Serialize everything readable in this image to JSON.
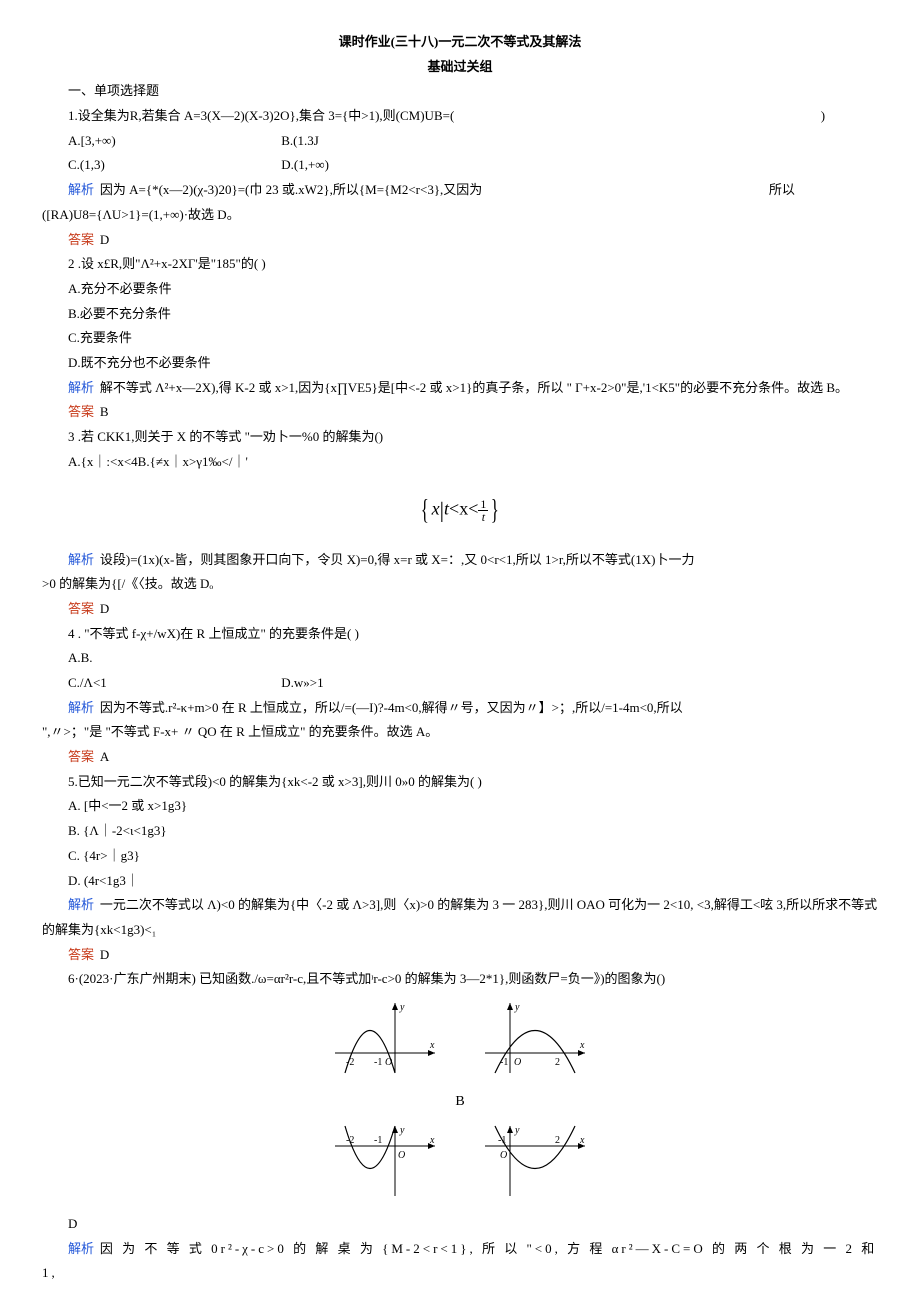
{
  "title_line1": "课时作业(三十八)一元二次不等式及其解法",
  "title_line2": "基础过关组",
  "section1": "一、单项选择题",
  "q1": {
    "stem": "1.设全集为R,若集合 A=3(X—2)(X-3)2O},集合 3={中>1),则(CM)UB=(",
    "paren": ")",
    "A": "A.[3,+∞)",
    "B": "B.(1.3J",
    "C": "C.(1,3)",
    "D": "D.(1,+∞)",
    "analysis_pre": "因为 A={*(x—2)(χ-3)20}=(巾 23 或.xW2},所以{M={M2<r<3},又因为",
    "analysis_post": "所以",
    "analysis_line2": "([RA)U8={ΛU>1}=(1,+∞)·故选 D。",
    "answer": "D"
  },
  "q2": {
    "stem": "2    .设 x£R,则\"Λ²+x-2XΓ'是\"185\"的(                          )",
    "A": "A.充分不必要条件",
    "B": "B.必要不充分条件",
    "C": "C.充要条件",
    "D": "D.既不充分也不必要条件",
    "analysis": "解不等式 Λ²+x—2X),得 K-2 或 x>1,因为{x∏VE5}是[中<-2 或 x>1}的真子条，所以 \" Γ+x-2>0\"是,'1<K5\"的必要不充分条件。故选 B。",
    "answer": "B"
  },
  "q3": {
    "stem": "3    .若 CKK1,则关于 X 的不等式 \"一劝卜一%0 的解集为()",
    "optA": "A.{x｜:<x<4B.{≠x｜x>γ1‰</｜'",
    "math_display": "{ x | t<x< 1/t }",
    "analysis_pre": "设段)=(1x)(x-皆，则其图象开口向下，令贝 X)=0,得 x=r 或 X=：,又 0<r<1,所以 1>r,所以不等式(1X)卜一力",
    "analysis_post": ">0 的解集为{[/《〈技。故选 Dₒ",
    "answer": "D"
  },
  "q4": {
    "stem": "4     . \"不等式 f-χ+/wX)在 R 上恒成立\" 的充要条件是(           )",
    "A": "A.B.",
    "C": "C./Λ<1",
    "D": "D.w»>1",
    "analysis": "因为不等式.r²-κ+m>0 在 R 上恒成立，所以/=(—I)?-4m<0,解得〃号，又因为〃】>；,所以/=1-4m<0,所以",
    "analysis2": "\",〃>；\"是 \"不等式 F-x+ 〃 QO 在 R 上恒成立\" 的充要条件。故选 A。",
    "answer": "A"
  },
  "q5": {
    "stem": "5.已知一元二次不等式段)<0 的解集为{xk<-2 或 x>3],则川 0»0 的解集为(                    )",
    "A": "A.    [中<一2 或 x>1g3}",
    "B": "B.    {Λ｜-2<ι<1g3}",
    "C": "C.    {4r>｜g3}",
    "D": "D.    (4r<1g3｜",
    "analysis": "一元二次不等式以 Λ)<0 的解集为{中〈-2 或 Λ>3],则〈x)>0 的解集为 3 一 283},则川 OAO 可化为一 2<10, <3,解得工<呟 3,所以所求不等式的解集为{xk<1g3)<₁",
    "answer": "D"
  },
  "q6": {
    "stem": "6·(2023·广东广州期末) 已知函数./ω=αr²r-c,且不等式加ᶦr-c>0 的解集为 3—2*1},则函数尸=负一》)的图象为()",
    "label_B": "B",
    "label_D": "D",
    "analysis": "因 为 不 等 式 0r²-χ-c>0 的 解 桌 为 {M-2<r<1}, 所 以 \"<0, 方 程 αr²—X-C=O 的 两 个 根 为 一 2 和 1,"
  },
  "labels": {
    "analysis": "解析",
    "answer": "答案"
  }
}
